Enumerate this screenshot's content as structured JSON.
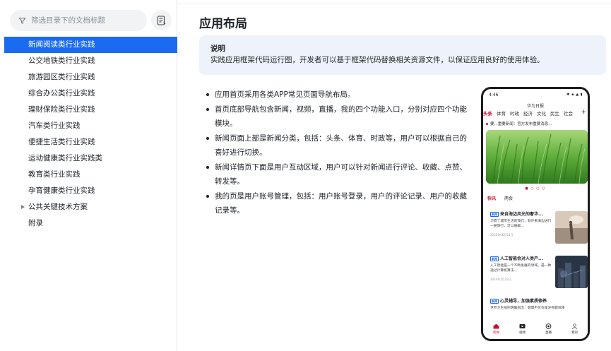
{
  "sidebar": {
    "filter_placeholder": "筛选目录下的文档标题",
    "items": [
      {
        "label": "新闻阅读类行业实践",
        "active": true
      },
      {
        "label": "公交地铁类行业实践"
      },
      {
        "label": "旅游园区类行业实践"
      },
      {
        "label": "综合办公类行业实践"
      },
      {
        "label": "理财保险类行业实践"
      },
      {
        "label": "汽车类行业实践"
      },
      {
        "label": "便捷生活类行业实践"
      },
      {
        "label": "运动健康类行业实践类"
      },
      {
        "label": "教育类行业实践"
      },
      {
        "label": "孕育健康类行业实践"
      },
      {
        "label": "公共关键技术方案",
        "expandable": true
      },
      {
        "label": "附录"
      }
    ]
  },
  "main": {
    "title": "应用布局",
    "note": {
      "title": "说明",
      "text": "实践应用框架代码运行图，开发者可以基于框架代码替换相关资源文件，以保证应用良好的使用体验。"
    },
    "bullets": [
      "应用首页采用各类APP常见页面导航布局。",
      "首页底部导航包含新闻，视频，直播，我的四个功能入口，分别对应四个功能模块。",
      "新闻页面上部是新闻分类，包括：头条、体育、时政等，用户可以根据自己的喜好进行切换。",
      "新闻详情页下面是用户互动区域，用户可以针对新闻进行评论、收藏、点赞、转发等。",
      "我的页是用户账号管理，包括：用户账号登录，用户的评论记录、用户的收藏记录等。"
    ]
  },
  "phone": {
    "time": "4:46",
    "status_icons": "✱ ◈ ▲ ▮",
    "app_title": "华为日报",
    "categories": [
      "头条",
      "体育",
      "时政",
      "经济",
      "文化",
      "民生",
      "社会"
    ],
    "add_label": "+",
    "ticker": "要...重要新闻：官方发布重要消息...",
    "tabs": [
      "快讯",
      "两会"
    ],
    "news": [
      {
        "tag": "新闻",
        "headline": "来自海边风光的奢华...",
        "summary": "习惯了城市生活的我们，就许来海边进行一趟旅行，可以缓解...",
        "date": "2022年06月18日"
      },
      {
        "tag": "新闻",
        "headline": "人工智能会对人类产...",
        "summary": "人工智能是一个不断发展的领域，是一种通过计算机算法...",
        "date": "2024年2月22日"
      },
      {
        "tag": "新闻",
        "headline": "心灵辅导，加强素质修养",
        "summary": "世界卫生组织明确指出：健康不仅仅是没有躯体疾",
        "date": ""
      }
    ],
    "bottom_nav": [
      {
        "label": "新闻",
        "icon": "home-icon",
        "active": true
      },
      {
        "label": "视频",
        "icon": "video-icon"
      },
      {
        "label": "直播",
        "icon": "live-icon"
      },
      {
        "label": "我的",
        "icon": "user-icon"
      }
    ]
  },
  "colors": {
    "accent": "#1a6bf0",
    "brand_red": "#c8102e",
    "note_bg": "#eef3fb"
  }
}
